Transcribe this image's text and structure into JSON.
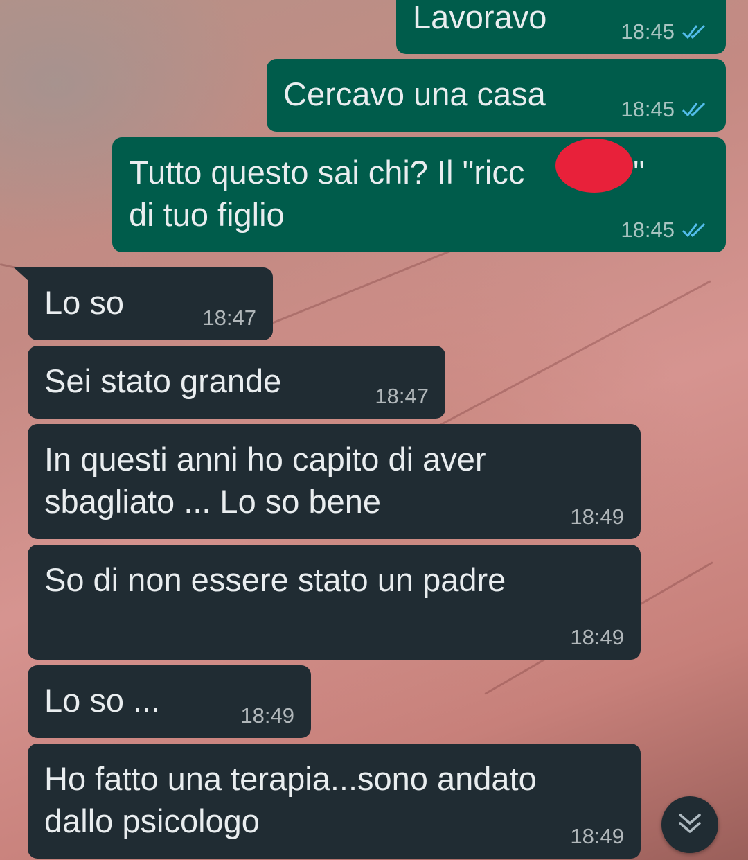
{
  "colors": {
    "outgoing_bubble": "#005c4b",
    "incoming_bubble": "#202c33",
    "message_text": "#e9edef",
    "read_ticks": "#53bdeb",
    "redaction": "#e8213a"
  },
  "messages": [
    {
      "direction": "outgoing",
      "text": "Lavoravo",
      "time": "18:45",
      "status": "read"
    },
    {
      "direction": "outgoing",
      "text": "Cercavo una casa",
      "time": "18:45",
      "status": "read"
    },
    {
      "direction": "outgoing",
      "text": "Tutto questo sai chi? Il \"ricc       ne \"\ndi tuo figlio",
      "time": "18:45",
      "status": "read",
      "redacted": true
    },
    {
      "direction": "incoming",
      "text": "Lo so",
      "time": "18:47"
    },
    {
      "direction": "incoming",
      "text": "Sei stato grande",
      "time": "18:47"
    },
    {
      "direction": "incoming",
      "text": "In questi anni ho capito di aver\nsbagliato ... Lo so bene",
      "time": "18:49"
    },
    {
      "direction": "incoming",
      "text": "So di non essere stato un padre",
      "time": "18:49"
    },
    {
      "direction": "incoming",
      "text": "Lo so ...",
      "time": "18:49"
    },
    {
      "direction": "incoming",
      "text": "Ho fatto una terapia...sono andato\ndallo psicologo",
      "time": "18:49"
    }
  ],
  "scroll_button": {
    "icon": "double-chevron-down-icon"
  }
}
